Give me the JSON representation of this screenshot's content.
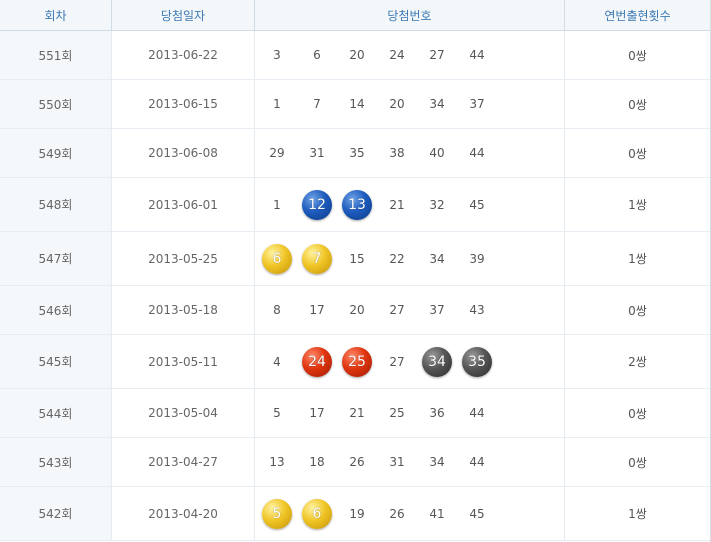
{
  "headers": {
    "round": "회차",
    "date": "당첨일자",
    "numbers": "당첨번호",
    "consecutive": "연번출현횟수"
  },
  "colors": {
    "blue": "#1d5bbd",
    "yellow": "#f0c526",
    "red": "#e0350f",
    "gray": "#555555",
    "header_text": "#3c79b3"
  },
  "rows": [
    {
      "round": "551회",
      "date": "2013-06-22",
      "count": "0쌍",
      "nums": [
        {
          "v": "3"
        },
        {
          "v": "6"
        },
        {
          "v": "20"
        },
        {
          "v": "24"
        },
        {
          "v": "27"
        },
        {
          "v": "44"
        }
      ]
    },
    {
      "round": "550회",
      "date": "2013-06-15",
      "count": "0쌍",
      "nums": [
        {
          "v": "1"
        },
        {
          "v": "7"
        },
        {
          "v": "14"
        },
        {
          "v": "20"
        },
        {
          "v": "34"
        },
        {
          "v": "37"
        }
      ]
    },
    {
      "round": "549회",
      "date": "2013-06-08",
      "count": "0쌍",
      "nums": [
        {
          "v": "29"
        },
        {
          "v": "31"
        },
        {
          "v": "35"
        },
        {
          "v": "38"
        },
        {
          "v": "40"
        },
        {
          "v": "44"
        }
      ]
    },
    {
      "round": "548회",
      "date": "2013-06-01",
      "count": "1쌍",
      "nums": [
        {
          "v": "1"
        },
        {
          "v": "12",
          "ball": "blue"
        },
        {
          "v": "13",
          "ball": "blue"
        },
        {
          "v": "21"
        },
        {
          "v": "32"
        },
        {
          "v": "45"
        }
      ]
    },
    {
      "round": "547회",
      "date": "2013-05-25",
      "count": "1쌍",
      "nums": [
        {
          "v": "6",
          "ball": "yellow"
        },
        {
          "v": "7",
          "ball": "yellow"
        },
        {
          "v": "15"
        },
        {
          "v": "22"
        },
        {
          "v": "34"
        },
        {
          "v": "39"
        }
      ]
    },
    {
      "round": "546회",
      "date": "2013-05-18",
      "count": "0쌍",
      "nums": [
        {
          "v": "8"
        },
        {
          "v": "17"
        },
        {
          "v": "20"
        },
        {
          "v": "27"
        },
        {
          "v": "37"
        },
        {
          "v": "43"
        }
      ]
    },
    {
      "round": "545회",
      "date": "2013-05-11",
      "count": "2쌍",
      "nums": [
        {
          "v": "4"
        },
        {
          "v": "24",
          "ball": "red"
        },
        {
          "v": "25",
          "ball": "red"
        },
        {
          "v": "27"
        },
        {
          "v": "34",
          "ball": "gray"
        },
        {
          "v": "35",
          "ball": "gray"
        }
      ]
    },
    {
      "round": "544회",
      "date": "2013-05-04",
      "count": "0쌍",
      "nums": [
        {
          "v": "5"
        },
        {
          "v": "17"
        },
        {
          "v": "21"
        },
        {
          "v": "25"
        },
        {
          "v": "36"
        },
        {
          "v": "44"
        }
      ]
    },
    {
      "round": "543회",
      "date": "2013-04-27",
      "count": "0쌍",
      "nums": [
        {
          "v": "13"
        },
        {
          "v": "18"
        },
        {
          "v": "26"
        },
        {
          "v": "31"
        },
        {
          "v": "34"
        },
        {
          "v": "44"
        }
      ]
    },
    {
      "round": "542회",
      "date": "2013-04-20",
      "count": "1쌍",
      "nums": [
        {
          "v": "5",
          "ball": "yellow"
        },
        {
          "v": "6",
          "ball": "yellow"
        },
        {
          "v": "19"
        },
        {
          "v": "26"
        },
        {
          "v": "41"
        },
        {
          "v": "45"
        }
      ]
    }
  ]
}
